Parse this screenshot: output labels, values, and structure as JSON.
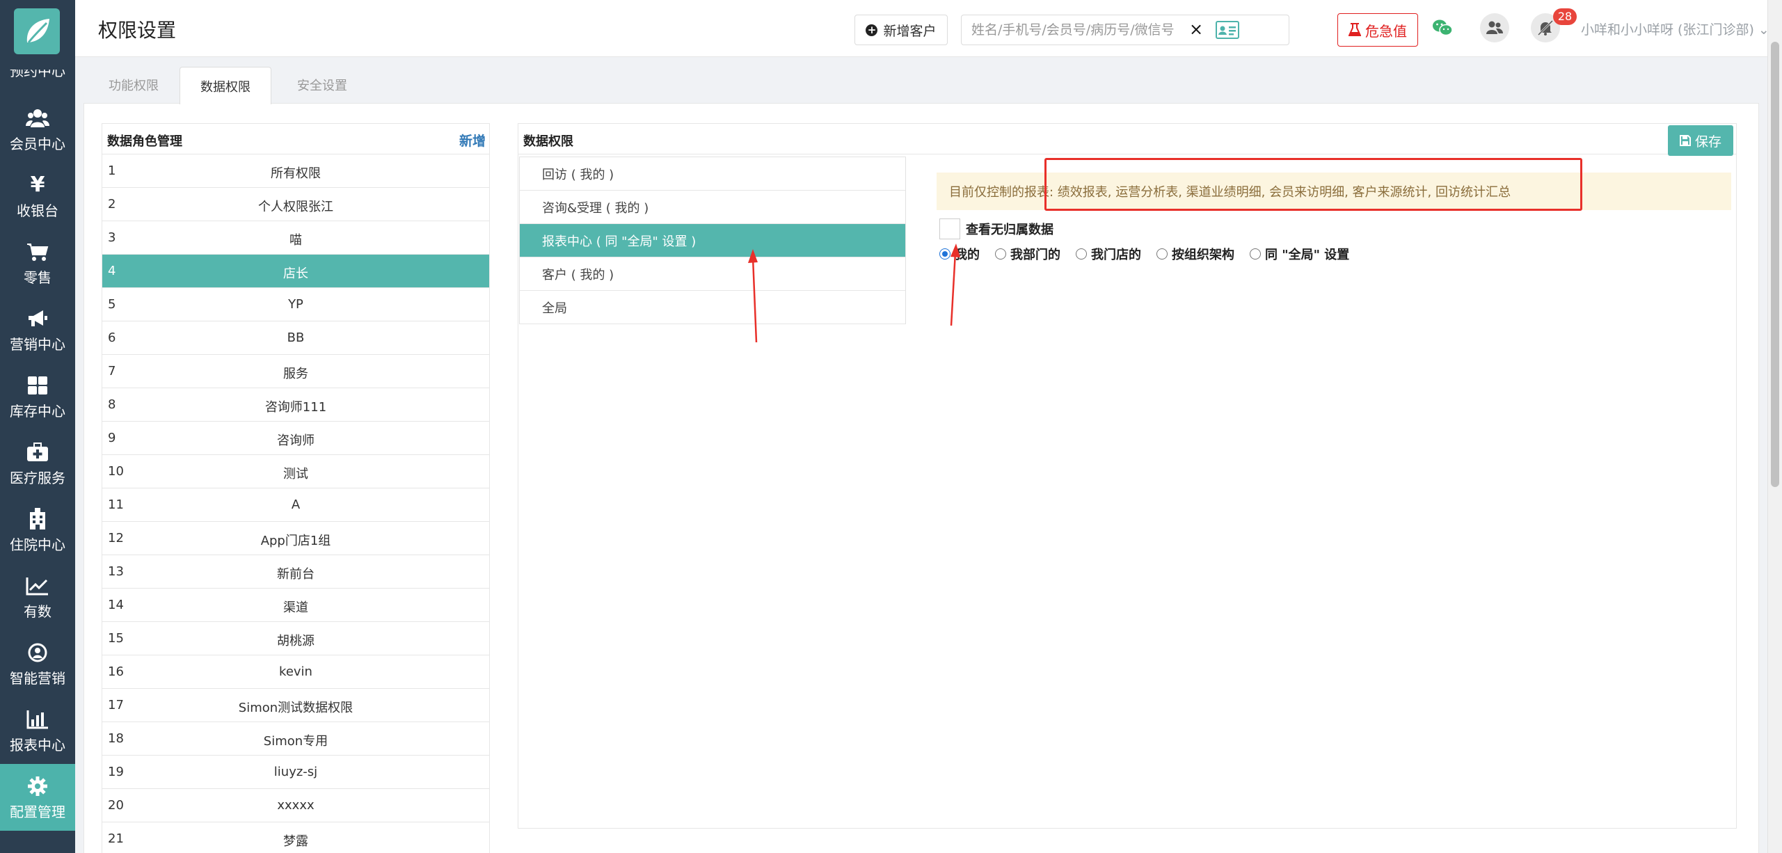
{
  "sidebar": {
    "partial_label": "预约中心",
    "items": [
      {
        "label": "会员中心",
        "icon": "users-icon"
      },
      {
        "label": "收银台",
        "icon": "yen-icon"
      },
      {
        "label": "零售",
        "icon": "cart-icon"
      },
      {
        "label": "营销中心",
        "icon": "megaphone-icon"
      },
      {
        "label": "库存中心",
        "icon": "grid-icon"
      },
      {
        "label": "医疗服务",
        "icon": "medkit-icon"
      },
      {
        "label": "住院中心",
        "icon": "hospital-icon"
      },
      {
        "label": "有数",
        "icon": "line-chart-icon"
      },
      {
        "label": "智能营销",
        "icon": "smart-icon"
      },
      {
        "label": "报表中心",
        "icon": "bar-chart-icon"
      },
      {
        "label": "配置管理",
        "icon": "gear-icon"
      }
    ],
    "active_index": 10
  },
  "header": {
    "title": "权限设置",
    "new_customer": "新增客户",
    "search_placeholder": "姓名/手机号/会员号/病历号/微信号",
    "clear": "×",
    "emergency": "危急值",
    "badge": "28",
    "user": "小咩和小小咩呀 (张江门诊部)"
  },
  "tabs": [
    {
      "label": "功能权限"
    },
    {
      "label": "数据权限"
    },
    {
      "label": "安全设置"
    }
  ],
  "active_tab": 1,
  "roles": {
    "title": "数据角色管理",
    "add": "新增",
    "active_index": 3,
    "rows": [
      {
        "num": "1",
        "name": "所有权限"
      },
      {
        "num": "2",
        "name": "个人权限张江"
      },
      {
        "num": "3",
        "name": "喵"
      },
      {
        "num": "4",
        "name": "店长"
      },
      {
        "num": "5",
        "name": "YP"
      },
      {
        "num": "6",
        "name": "BB"
      },
      {
        "num": "7",
        "name": "服务"
      },
      {
        "num": "8",
        "name": "咨询师111"
      },
      {
        "num": "9",
        "name": "咨询师"
      },
      {
        "num": "10",
        "name": "测试"
      },
      {
        "num": "11",
        "name": "A"
      },
      {
        "num": "12",
        "name": "App门店1组"
      },
      {
        "num": "13",
        "name": "新前台"
      },
      {
        "num": "14",
        "name": "渠道"
      },
      {
        "num": "15",
        "name": "胡桃源"
      },
      {
        "num": "16",
        "name": "kevin"
      },
      {
        "num": "17",
        "name": "Simon测试数据权限"
      },
      {
        "num": "18",
        "name": "Simon专用"
      },
      {
        "num": "19",
        "name": "liuyz-sj"
      },
      {
        "num": "20",
        "name": "xxxxx"
      },
      {
        "num": "21",
        "name": "梦露"
      }
    ]
  },
  "data_perm": {
    "title": "数据权限",
    "save": "保存",
    "active_module": 2,
    "modules": [
      {
        "label": "回访 ( 我的 )"
      },
      {
        "label": "咨询&受理 ( 我的 )"
      },
      {
        "label": "报表中心 ( 同 \"全局\" 设置 )"
      },
      {
        "label": "客户 ( 我的 )"
      },
      {
        "label": "全局"
      }
    ],
    "notice": "目前仅控制的报表: 绩效报表, 运营分析表, 渠道业绩明细, 会员来访明细, 客户来源统计, 回访统计汇总",
    "checkbox_label": "查看无归属数据",
    "radio_selected": 0,
    "radios": [
      {
        "label": "我的"
      },
      {
        "label": "我部门的"
      },
      {
        "label": "我门店的"
      },
      {
        "label": "按组织架构"
      },
      {
        "label": "同 \"全局\" 设置"
      }
    ]
  },
  "colors": {
    "sidebar_bg": "#2c3e50",
    "accent": "#54b6ad",
    "danger": "#e02020",
    "link": "#337ab7",
    "notice_bg": "#fcf5e0",
    "annotation": "#e8302a"
  }
}
